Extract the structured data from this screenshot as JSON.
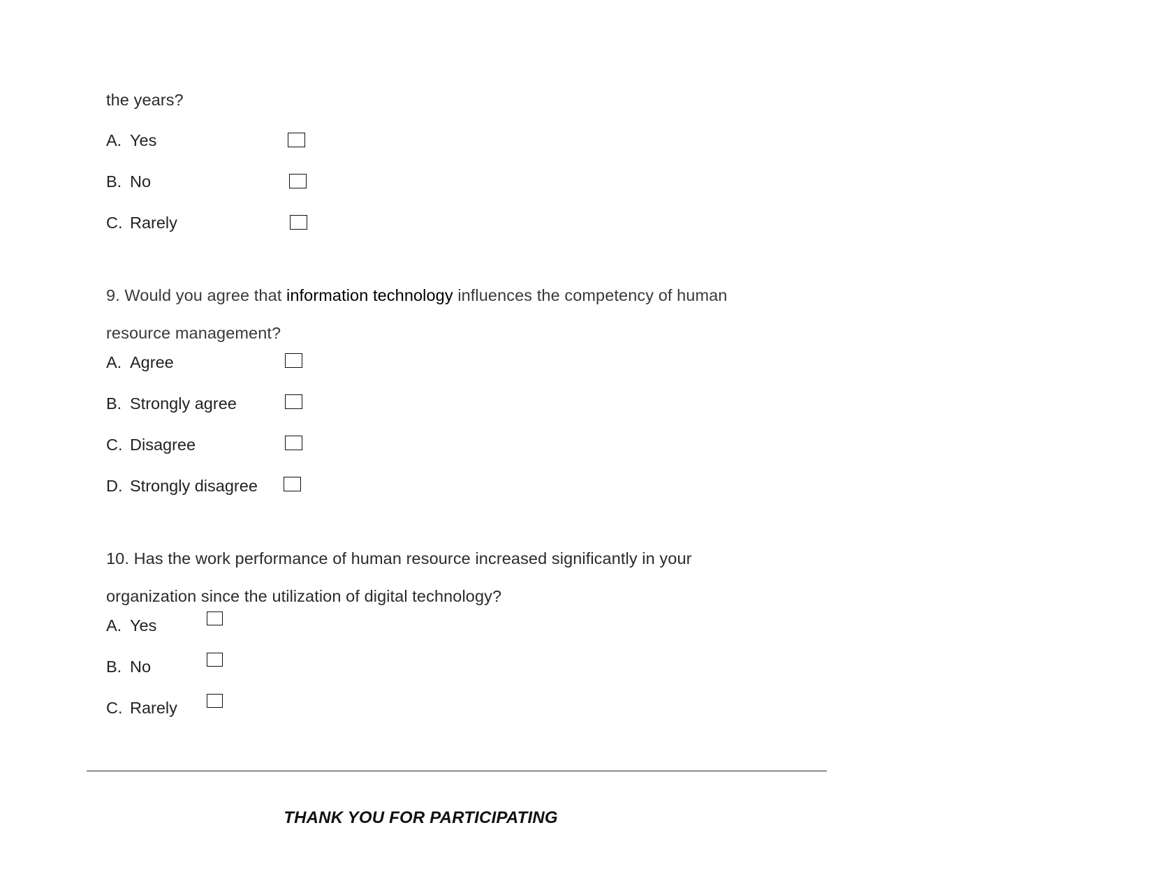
{
  "document": {
    "type": "questionnaire-page",
    "background_color": "#ffffff",
    "text_color": "#2b2b2b"
  },
  "carryover_question": {
    "continuation_text": "the years?",
    "options": [
      {
        "letter": "A.",
        "label": "Yes"
      },
      {
        "letter": "B.",
        "label": "No"
      },
      {
        "letter": "C.",
        "label": "Rarely"
      }
    ]
  },
  "question_9": {
    "line1_before": "9. Would you agree that ",
    "line1_emphasis": "information technology",
    "line1_after": " influences the competency of human",
    "line2": "resource management?",
    "options": [
      {
        "letter": "A.",
        "label": "Agree"
      },
      {
        "letter": "B.",
        "label": "Strongly agree"
      },
      {
        "letter": "C.",
        "label": "Disagree"
      },
      {
        "letter": "D.",
        "label": "Strongly disagree"
      }
    ]
  },
  "question_10": {
    "line1": "10. Has the work performance of human resource increased significantly in your",
    "line2": "organization since the utilization of digital technology?",
    "options": [
      {
        "letter": "A.",
        "label": "Yes"
      },
      {
        "letter": "B.",
        "label": "No"
      },
      {
        "letter": "C.",
        "label": "Rarely"
      }
    ]
  },
  "footer": {
    "message": "THANK YOU FOR PARTICIPATING"
  }
}
